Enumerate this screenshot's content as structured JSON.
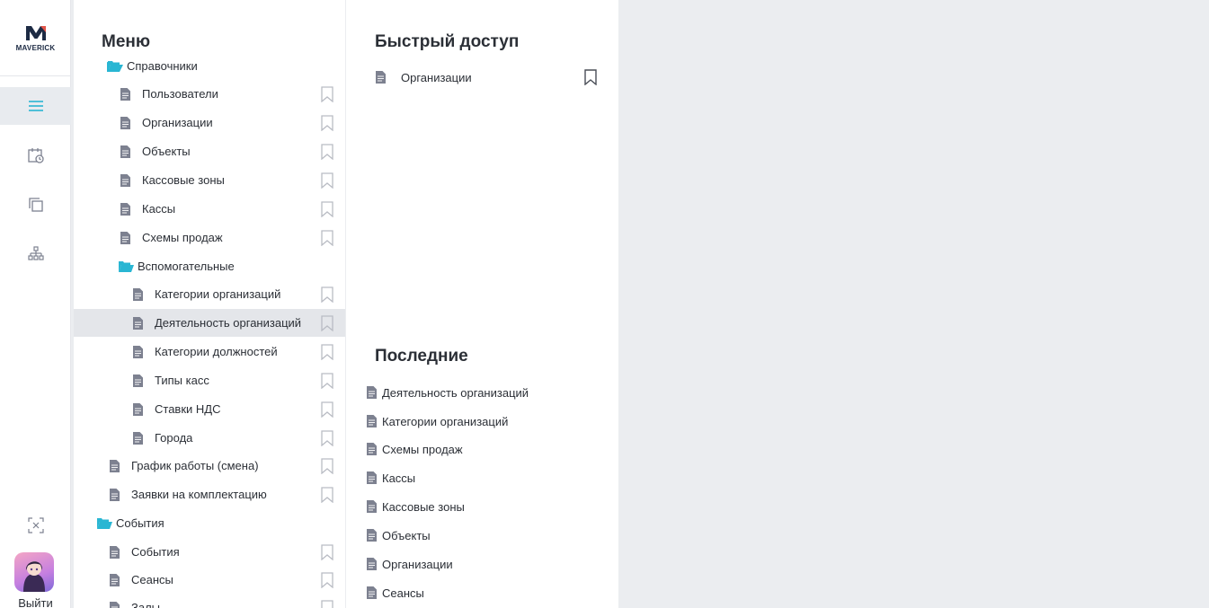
{
  "app": {
    "logo_text": "MAVERICK",
    "accent": "#29b6d3",
    "icon_color": "#7d8190"
  },
  "rail": {
    "items": [
      "menu-icon",
      "calendar-clock-icon",
      "copy-icon",
      "org-structure-icon"
    ],
    "bottom_icon": "collapse-icon",
    "logout_label": "Выйти"
  },
  "menu": {
    "title": "Меню",
    "items": [
      {
        "label": "Справочники",
        "type": "folder"
      },
      {
        "label": "Пользователи",
        "type": "doc"
      },
      {
        "label": "Организации",
        "type": "doc"
      },
      {
        "label": "Объекты",
        "type": "doc"
      },
      {
        "label": "Кассовые зоны",
        "type": "doc"
      },
      {
        "label": "Кассы",
        "type": "doc"
      },
      {
        "label": "Схемы продаж",
        "type": "doc"
      },
      {
        "label": "Вспомогательные",
        "type": "folder"
      },
      {
        "label": "Категории организаций",
        "type": "doc"
      },
      {
        "label": "Деятельность организаций",
        "type": "doc",
        "selected": true
      },
      {
        "label": "Категории должностей",
        "type": "doc"
      },
      {
        "label": "Типы касс",
        "type": "doc"
      },
      {
        "label": "Ставки НДС",
        "type": "doc"
      },
      {
        "label": "Города",
        "type": "doc"
      },
      {
        "label": "График работы (смена)",
        "type": "doc"
      },
      {
        "label": "Заявки на комплектацию",
        "type": "doc"
      },
      {
        "label": "События",
        "type": "folder"
      },
      {
        "label": "События",
        "type": "doc"
      },
      {
        "label": "Сеансы",
        "type": "doc"
      },
      {
        "label": "Залы",
        "type": "doc"
      }
    ]
  },
  "quick_access": {
    "title": "Быстрый доступ",
    "items": [
      "Организации"
    ]
  },
  "recent": {
    "title": "Последние",
    "items": [
      "Деятельность организаций",
      "Категории организаций",
      "Схемы продаж",
      "Кассы",
      "Кассовые зоны",
      "Объекты",
      "Организации",
      "Сеансы"
    ]
  }
}
